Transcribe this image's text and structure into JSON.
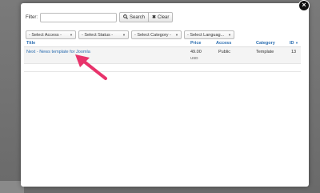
{
  "filter": {
    "label": "Filter:",
    "value": "",
    "search_label": "Search",
    "clear_label": "Clear"
  },
  "close_label": "×",
  "selects": [
    {
      "label": "- Select Access -"
    },
    {
      "label": "- Select Status -"
    },
    {
      "label": "- Select Category -"
    },
    {
      "label": "- Select Languag..."
    }
  ],
  "table": {
    "headers": {
      "title": "Title",
      "price": "Price",
      "access": "Access",
      "category": "Category",
      "id": "ID"
    },
    "rows": [
      {
        "title": "Next - News template for Joomla",
        "price": "49.00",
        "currency": "USD",
        "access": "Public",
        "category": "Template",
        "id": "13"
      }
    ]
  },
  "colors": {
    "link": "#2a6db0",
    "arrow": "#e8336b"
  }
}
